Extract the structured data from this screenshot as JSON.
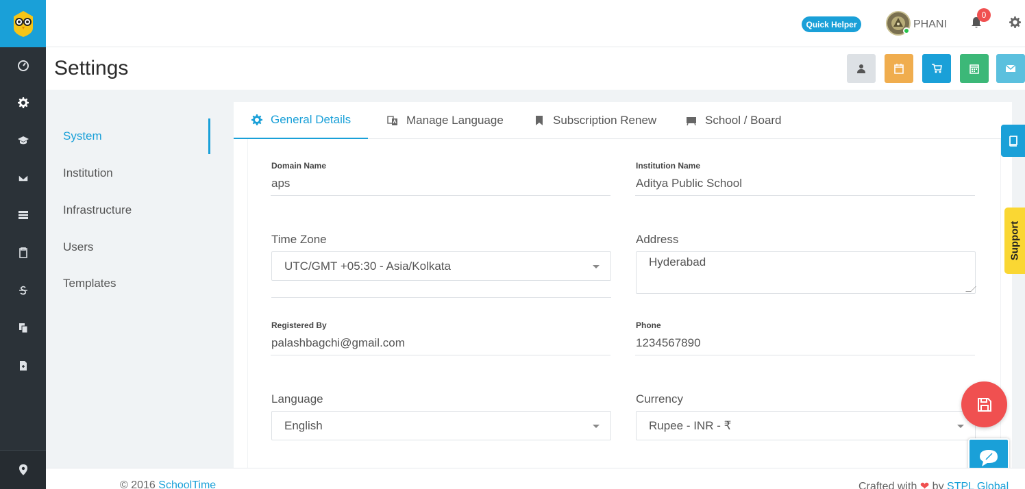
{
  "header": {
    "quick_helper": "Quick Helper",
    "user_name": "PHANI",
    "notification_count": "0"
  },
  "page": {
    "title": "Settings"
  },
  "header_buttons": [
    {
      "icon": "user-icon",
      "color": "#dde1e5"
    },
    {
      "icon": "calendar-icon",
      "color": "#f0ad4e"
    },
    {
      "icon": "cart-icon",
      "color": "#1aa0d8"
    },
    {
      "icon": "calendar-grid-icon",
      "color": "#3cb878"
    },
    {
      "icon": "mail-icon",
      "color": "#5bc0de"
    }
  ],
  "settings_nav": {
    "items": [
      {
        "label": "System",
        "active": true
      },
      {
        "label": "Institution"
      },
      {
        "label": "Infrastructure"
      },
      {
        "label": "Users"
      },
      {
        "label": "Templates"
      }
    ]
  },
  "tabs": [
    {
      "label": "General Details",
      "icon": "gear-icon",
      "active": true
    },
    {
      "label": "Manage Language",
      "icon": "translate-icon"
    },
    {
      "label": "Subscription Renew",
      "icon": "bookmark-icon"
    },
    {
      "label": "School / Board",
      "icon": "board-icon"
    }
  ],
  "form": {
    "domain_name": {
      "label": "Domain Name",
      "value": "aps"
    },
    "institution_name": {
      "label": "Institution Name",
      "value": "Aditya Public School"
    },
    "time_zone": {
      "label": "Time Zone",
      "value": "UTC/GMT +05:30 - Asia/Kolkata"
    },
    "address": {
      "label": "Address",
      "value": "Hyderabad"
    },
    "registered_by": {
      "label": "Registered By",
      "value": "palashbagchi@gmail.com"
    },
    "phone": {
      "label": "Phone",
      "value": "1234567890"
    },
    "language": {
      "label": "Language",
      "value": "English"
    },
    "currency": {
      "label": "Currency",
      "value": "Rupee - INR - ₹"
    }
  },
  "widgets": {
    "support": "Support"
  },
  "footer": {
    "copyright": "© 2016 ",
    "brand": "SchoolTime",
    "crafted_prefix": "Crafted with ",
    "heart": "❤",
    "by": " by ",
    "company": "STPL Global"
  },
  "colors": {
    "accent": "#1aa0d8",
    "sidebar": "#2b3238",
    "danger": "#f05050",
    "support": "#fad733"
  }
}
